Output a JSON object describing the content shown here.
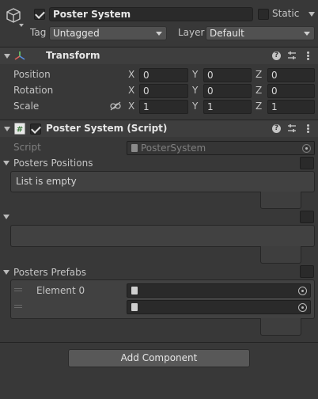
{
  "gameobject": {
    "name": "Poster System",
    "active": true,
    "static_label": "Static",
    "tag_label": "Tag",
    "tag_value": "Untagged",
    "layer_label": "Layer",
    "layer_value": "Default"
  },
  "transform": {
    "title": "Transform",
    "rows": [
      {
        "label": "Position",
        "x": "0",
        "y": "0",
        "z": "0"
      },
      {
        "label": "Rotation",
        "x": "0",
        "y": "0",
        "z": "0"
      },
      {
        "label": "Scale",
        "x": "1",
        "y": "1",
        "z": "1"
      }
    ],
    "axis_x": "X",
    "axis_y": "Y",
    "axis_z": "Z"
  },
  "script_component": {
    "title": "Poster System (Script)",
    "enabled": true,
    "script_label": "Script",
    "script_value": "PosterSystem",
    "posters_positions_label": "Posters Positions",
    "list_empty_text": "List is empty",
    "posters_prefabs_label": "Posters Prefabs",
    "element0_label": "Element 0"
  },
  "footer": {
    "add_component_label": "Add Component"
  },
  "icons": [
    "gameobject-cube-icon",
    "transform-axes-icon",
    "script-hash-icon",
    "help-icon",
    "preset-sliders-icon",
    "kebab-menu-icon",
    "object-picker-icon",
    "constrain-link-icon"
  ],
  "colors": {
    "background": "#383838",
    "field": "#2a2a2a",
    "header": "#3e3e3e",
    "text": "#d2d2d2"
  }
}
